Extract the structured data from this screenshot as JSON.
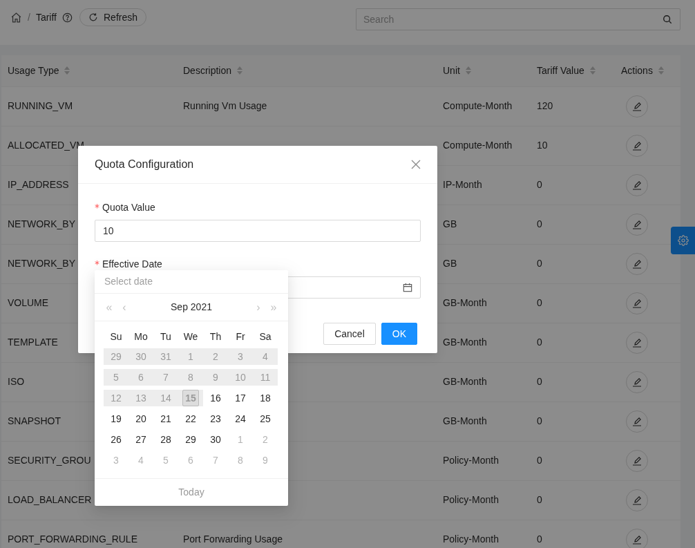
{
  "breadcrumb": {
    "separator": "/",
    "current": "Tariff"
  },
  "refresh_button": "Refresh",
  "search": {
    "placeholder": "Search"
  },
  "table": {
    "columns": [
      "Usage Type",
      "Description",
      "Unit",
      "Tariff Value",
      "Actions"
    ],
    "rows": [
      {
        "usage_type": "RUNNING_VM",
        "description": "Running Vm Usage",
        "unit": "Compute-Month",
        "tariff_value": "120"
      },
      {
        "usage_type": "ALLOCATED_VM",
        "unit": "Compute-Month",
        "tariff_value": "10"
      },
      {
        "usage_type": "IP_ADDRESS",
        "unit": "IP-Month",
        "tariff_value": "0"
      },
      {
        "usage_type": "NETWORK_BY",
        "unit": "GB",
        "tariff_value": "0"
      },
      {
        "usage_type": "NETWORK_BY",
        "unit": "GB",
        "tariff_value": "0"
      },
      {
        "usage_type": "VOLUME",
        "unit": "GB-Month",
        "tariff_value": "0"
      },
      {
        "usage_type": "TEMPLATE",
        "unit": "GB-Month",
        "tariff_value": "0"
      },
      {
        "usage_type": "ISO",
        "unit": "GB-Month",
        "tariff_value": "0"
      },
      {
        "usage_type": "SNAPSHOT",
        "unit": "GB-Month",
        "tariff_value": "0"
      },
      {
        "usage_type": "SECURITY_GROU",
        "unit": "Policy-Month",
        "tariff_value": "0"
      },
      {
        "usage_type": "LOAD_BALANCER",
        "unit": "Policy-Month",
        "tariff_value": "0"
      },
      {
        "usage_type": "PORT_FORWARDING_RULE",
        "description": "Port Forwarding Usage",
        "unit": "Policy-Month",
        "tariff_value": "0"
      }
    ]
  },
  "modal": {
    "title": "Quota Configuration",
    "fields": [
      {
        "kind": "text",
        "required_mark": "*",
        "label": "Quota Value",
        "value": "10"
      },
      {
        "kind": "date",
        "required_mark": "*",
        "label": "Effective Date"
      }
    ],
    "buttons": [
      {
        "label": "Cancel",
        "primary": false
      },
      {
        "label": "OK",
        "primary": true
      }
    ]
  },
  "date_picker": {
    "placeholder": "Select date",
    "month": "Sep 2021",
    "nav": [
      "«",
      "‹",
      "›",
      "»"
    ],
    "weekdays": [
      "Su",
      "Mo",
      "Tu",
      "We",
      "Th",
      "Fr",
      "Sa"
    ],
    "weeks": [
      [
        {
          "text": "29",
          "disabled": true
        },
        {
          "text": "30",
          "disabled": true
        },
        {
          "text": "31",
          "disabled": true
        },
        {
          "text": "1",
          "disabled": true
        },
        {
          "text": "2",
          "disabled": true
        },
        {
          "text": "3",
          "disabled": true
        },
        {
          "text": "4",
          "disabled": true
        }
      ],
      [
        {
          "text": "5",
          "disabled": true
        },
        {
          "text": "6",
          "disabled": true
        },
        {
          "text": "7",
          "disabled": true
        },
        {
          "text": "8",
          "disabled": true
        },
        {
          "text": "9",
          "disabled": true
        },
        {
          "text": "10",
          "disabled": true
        },
        {
          "text": "11",
          "disabled": true
        }
      ],
      [
        {
          "text": "12",
          "disabled": true
        },
        {
          "text": "13",
          "disabled": true
        },
        {
          "text": "14",
          "disabled": true
        },
        {
          "text": "15",
          "disabled": true,
          "today": true
        },
        {
          "text": "16",
          "muted": false,
          "disabled": false
        },
        {
          "text": "17",
          "muted": false,
          "disabled": false
        },
        {
          "text": "18",
          "muted": false,
          "disabled": false
        }
      ],
      [
        {
          "text": "19",
          "muted": false,
          "disabled": false
        },
        {
          "text": "20",
          "muted": false,
          "disabled": false
        },
        {
          "text": "21",
          "muted": false,
          "disabled": false
        },
        {
          "text": "22",
          "muted": false,
          "disabled": false
        },
        {
          "text": "23",
          "muted": false,
          "disabled": false
        },
        {
          "text": "24",
          "muted": false,
          "disabled": false
        },
        {
          "text": "25",
          "muted": false,
          "disabled": false
        }
      ],
      [
        {
          "text": "26",
          "muted": false,
          "disabled": false
        },
        {
          "text": "27",
          "muted": false,
          "disabled": false
        },
        {
          "text": "28",
          "muted": false,
          "disabled": false
        },
        {
          "text": "29",
          "muted": false,
          "disabled": false
        },
        {
          "text": "30",
          "muted": false,
          "disabled": false
        },
        {
          "text": "1",
          "muted": true,
          "disabled": false
        },
        {
          "text": "2",
          "muted": true,
          "disabled": false
        }
      ],
      [
        {
          "text": "3",
          "muted": true,
          "disabled": false
        },
        {
          "text": "4",
          "muted": true,
          "disabled": false
        },
        {
          "text": "5",
          "muted": true,
          "disabled": false
        },
        {
          "text": "6",
          "muted": true,
          "disabled": false
        },
        {
          "text": "7",
          "muted": true,
          "disabled": false
        },
        {
          "text": "8",
          "muted": true,
          "disabled": false
        },
        {
          "text": "9",
          "muted": true,
          "disabled": false
        }
      ]
    ],
    "footer": {
      "label": "Today",
      "disabled": true
    }
  }
}
